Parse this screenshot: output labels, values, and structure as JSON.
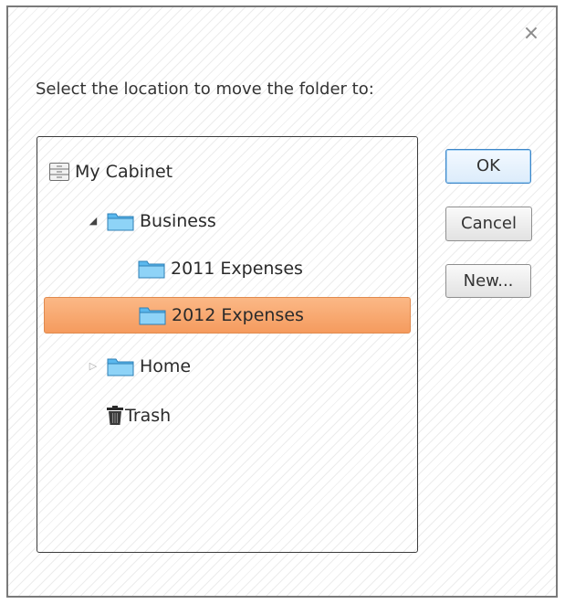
{
  "dialog": {
    "close_glyph": "×",
    "prompt": "Select the location to move the folder to:"
  },
  "tree": {
    "items": [
      {
        "label": "My Cabinet",
        "icon": "cabinet-icon",
        "expander": "none",
        "selected": false
      },
      {
        "label": "Business",
        "icon": "folder-icon",
        "expander": "expanded",
        "selected": false
      },
      {
        "label": "2011 Expenses",
        "icon": "folder-icon",
        "expander": "none",
        "selected": false
      },
      {
        "label": "2012 Expenses",
        "icon": "folder-icon",
        "expander": "none",
        "selected": true
      },
      {
        "label": "Home",
        "icon": "folder-icon",
        "expander": "collapsed",
        "selected": false
      },
      {
        "label": "Trash",
        "icon": "trash-icon",
        "expander": "none",
        "selected": false
      }
    ]
  },
  "buttons": {
    "ok": "OK",
    "cancel": "Cancel",
    "new": "New..."
  },
  "colors": {
    "selection": "#f7a56e",
    "selection_border": "#e08a4e",
    "folder": "#5ab8ee",
    "default_button_border": "#3d86c8"
  }
}
